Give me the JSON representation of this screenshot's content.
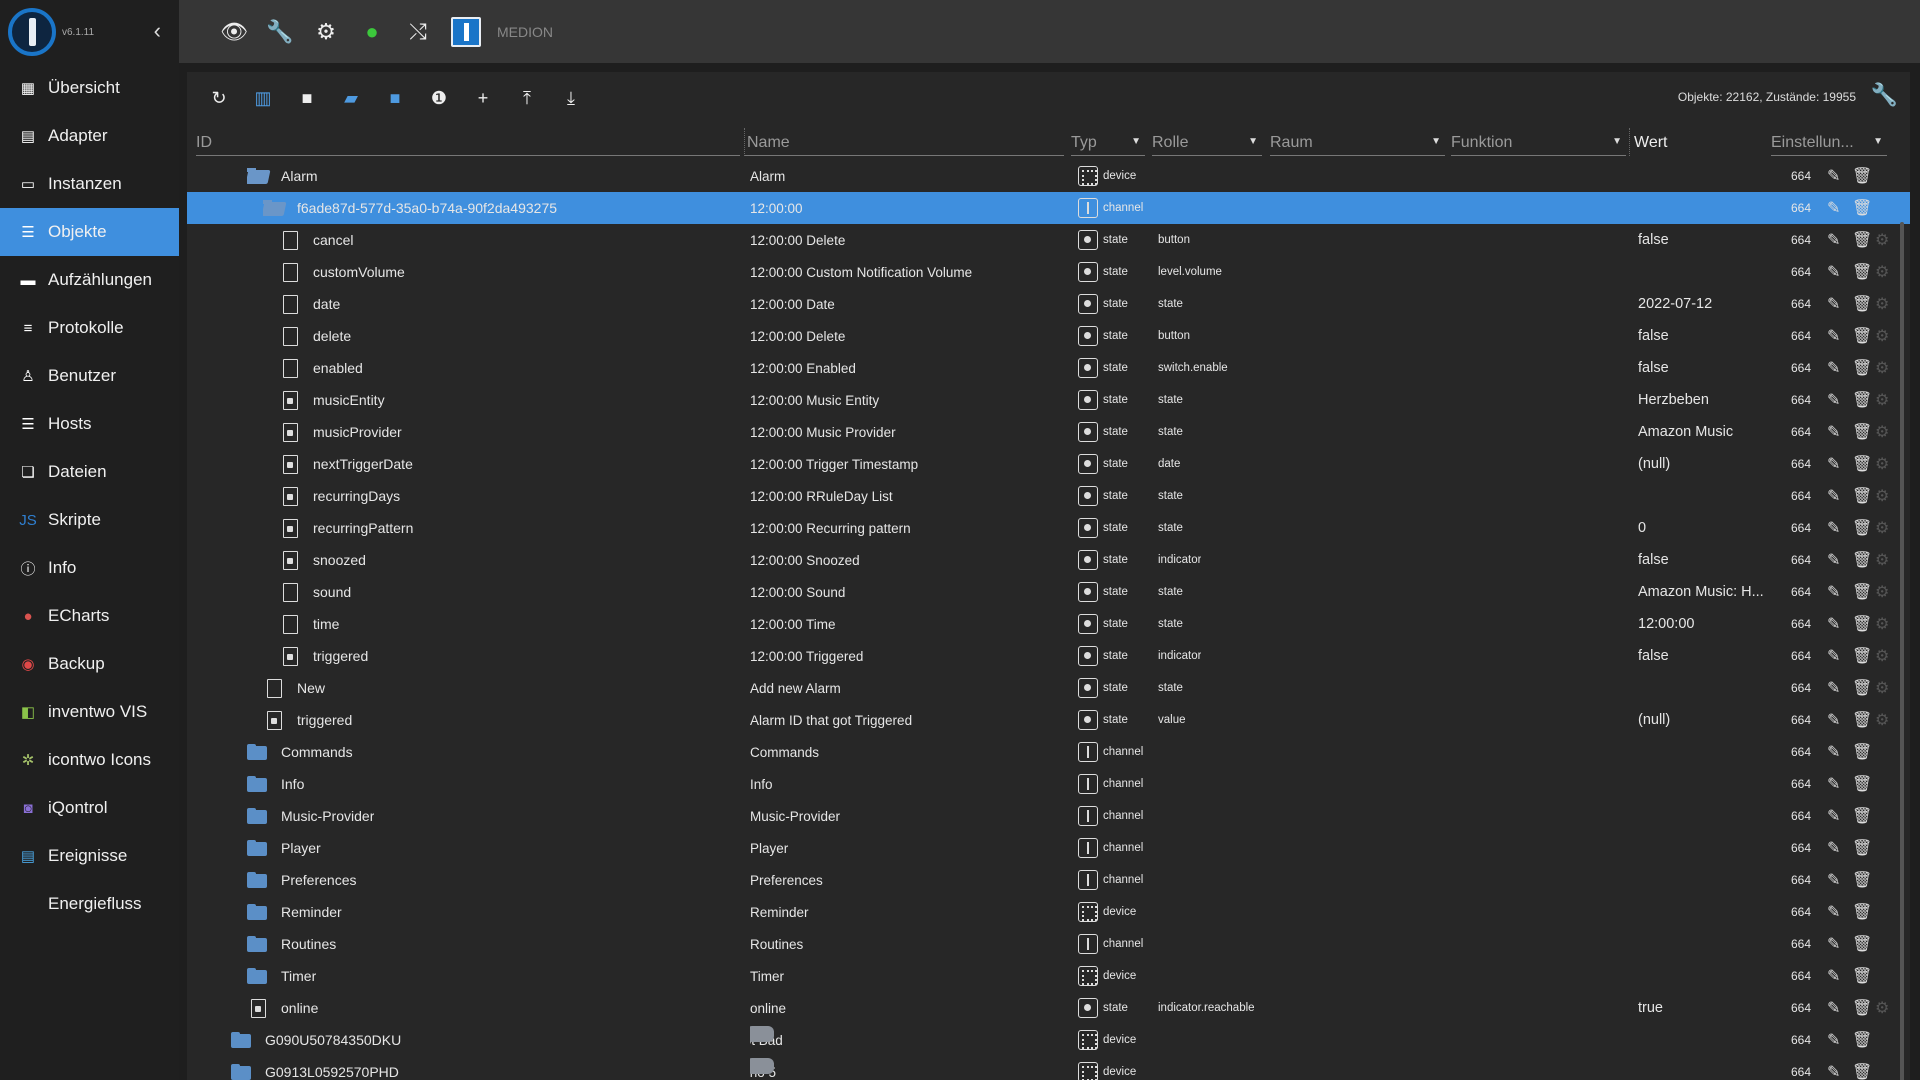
{
  "app": {
    "version": "v6.1.11",
    "hostname": "MEDION"
  },
  "sidebar": {
    "items": [
      {
        "label": "Übersicht",
        "icon": "grid-icon",
        "glyph": "▦",
        "color": "#ffffff"
      },
      {
        "label": "Adapter",
        "icon": "store-icon",
        "glyph": "▤",
        "color": "#ffffff"
      },
      {
        "label": "Instanzen",
        "icon": "instances-icon",
        "glyph": "▭",
        "color": "#ffffff"
      },
      {
        "label": "Objekte",
        "icon": "list-icon",
        "glyph": "☰",
        "color": "#ffffff",
        "active": true
      },
      {
        "label": "Aufzählungen",
        "icon": "enum-icon",
        "glyph": "▬",
        "color": "#ffffff"
      },
      {
        "label": "Protokolle",
        "icon": "log-icon",
        "glyph": "≡",
        "color": "#ffffff"
      },
      {
        "label": "Benutzer",
        "icon": "user-icon",
        "glyph": "♙",
        "color": "#ffffff"
      },
      {
        "label": "Hosts",
        "icon": "hosts-icon",
        "glyph": "☰",
        "color": "#ffffff"
      },
      {
        "label": "Dateien",
        "icon": "files-icon",
        "glyph": "❏",
        "color": "#ffffff"
      },
      {
        "label": "Skripte",
        "icon": "javascript-icon",
        "glyph": "JS",
        "color": "#2f7fd0"
      },
      {
        "label": "Info",
        "icon": "info-icon",
        "glyph": "ⓘ",
        "color": "#ffffff"
      },
      {
        "label": "ECharts",
        "icon": "echarts-icon",
        "glyph": "●",
        "color": "#d9534f"
      },
      {
        "label": "Backup",
        "icon": "backup-icon",
        "glyph": "◉",
        "color": "#e04848"
      },
      {
        "label": "inventwo VIS",
        "icon": "inventwo-icon",
        "glyph": "◧",
        "color": "#8bc34a"
      },
      {
        "label": "icontwo Icons",
        "icon": "icontwo-icon",
        "glyph": "✲",
        "color": "#a6c36a"
      },
      {
        "label": "iQontrol",
        "icon": "iqontrol-icon",
        "glyph": "◙",
        "color": "#8a6fd6"
      },
      {
        "label": "Ereignisse",
        "icon": "events-icon",
        "glyph": "▤",
        "color": "#4aa3e0"
      },
      {
        "label": "Energiefluss",
        "icon": "energy-icon",
        "glyph": "",
        "color": "#ffffff"
      }
    ]
  },
  "topbar": {
    "icons": [
      {
        "name": "eye-icon",
        "glyph": "👁",
        "color": "#eeeeee"
      },
      {
        "name": "wrench-icon",
        "glyph": "🔧",
        "color": "#eeeeee"
      },
      {
        "name": "gear-icon",
        "glyph": "⚙",
        "color": "#eeeeee"
      },
      {
        "name": "expert-head-icon",
        "glyph": "●",
        "color": "#3cc83c"
      },
      {
        "name": "sync-icon",
        "glyph": "⤭",
        "color": "#eeeeee"
      }
    ]
  },
  "toolbar": {
    "tools": [
      {
        "name": "refresh-icon",
        "glyph": "↻",
        "blue": false
      },
      {
        "name": "columns-icon",
        "glyph": "▥",
        "blue": true
      },
      {
        "name": "folder-icon",
        "glyph": "■",
        "blue": false
      },
      {
        "name": "folder-open-icon",
        "glyph": "▰",
        "blue": true
      },
      {
        "name": "folder-closed-icon",
        "glyph": "■",
        "blue": true
      },
      {
        "name": "number-one-icon",
        "glyph": "❶",
        "blue": false
      },
      {
        "name": "add-icon",
        "glyph": "+",
        "blue": false
      },
      {
        "name": "upload-icon",
        "glyph": "⤒",
        "blue": false
      },
      {
        "name": "download-icon",
        "glyph": "⤓",
        "blue": false
      }
    ],
    "counts": "Objekte: 22162, Zustände: 19955"
  },
  "columns": {
    "id": "ID",
    "name": "Name",
    "type": "Typ",
    "role": "Rolle",
    "room": "Raum",
    "function": "Funktion",
    "value": "Wert",
    "settings": "Einstellun..."
  },
  "rows": [
    {
      "indent": 1,
      "icon": "folder-open",
      "id": "Alarm",
      "name": "Alarm",
      "type": "device",
      "role": "",
      "value": "",
      "acl": "664",
      "cfg": false
    },
    {
      "indent": 2,
      "icon": "folder-open",
      "id": "f6ade87d-577d-35a0-b74a-90f2da493275",
      "name": "12:00:00",
      "type": "channel",
      "role": "",
      "value": "",
      "acl": "664",
      "cfg": false,
      "selected": true
    },
    {
      "indent": 3,
      "icon": "file",
      "id": "cancel",
      "name": "12:00:00 Delete",
      "type": "state",
      "role": "button",
      "value": "false",
      "acl": "664",
      "cfg": true
    },
    {
      "indent": 3,
      "icon": "file",
      "id": "customVolume",
      "name": "12:00:00 Custom Notification Volume",
      "type": "state",
      "role": "level.volume",
      "value": "",
      "acl": "664",
      "cfg": true
    },
    {
      "indent": 3,
      "icon": "file",
      "id": "date",
      "name": "12:00:00 Date",
      "type": "state",
      "role": "state",
      "value": "2022-07-12",
      "acl": "664",
      "cfg": true
    },
    {
      "indent": 3,
      "icon": "file",
      "id": "delete",
      "name": "12:00:00 Delete",
      "type": "state",
      "role": "button",
      "value": "false",
      "acl": "664",
      "cfg": true
    },
    {
      "indent": 3,
      "icon": "file",
      "id": "enabled",
      "name": "12:00:00 Enabled",
      "type": "state",
      "role": "switch.enable",
      "value": "false",
      "acl": "664",
      "cfg": true
    },
    {
      "indent": 3,
      "icon": "file-lock",
      "id": "musicEntity",
      "name": "12:00:00 Music Entity",
      "type": "state",
      "role": "state",
      "value": "Herzbeben",
      "acl": "664",
      "cfg": true
    },
    {
      "indent": 3,
      "icon": "file-lock",
      "id": "musicProvider",
      "name": "12:00:00 Music Provider",
      "type": "state",
      "role": "state",
      "value": "Amazon Music",
      "acl": "664",
      "cfg": true
    },
    {
      "indent": 3,
      "icon": "file-lock",
      "id": "nextTriggerDate",
      "name": "12:00:00 Trigger Timestamp",
      "type": "state",
      "role": "date",
      "value": "(null)",
      "acl": "664",
      "cfg": true
    },
    {
      "indent": 3,
      "icon": "file-lock",
      "id": "recurringDays",
      "name": "12:00:00 RRuleDay List",
      "type": "state",
      "role": "state",
      "value": "",
      "acl": "664",
      "cfg": true
    },
    {
      "indent": 3,
      "icon": "file-lock",
      "id": "recurringPattern",
      "name": "12:00:00 Recurring pattern",
      "type": "state",
      "role": "state",
      "value": "0",
      "acl": "664",
      "cfg": true
    },
    {
      "indent": 3,
      "icon": "file-lock",
      "id": "snoozed",
      "name": "12:00:00 Snoozed",
      "type": "state",
      "role": "indicator",
      "value": "false",
      "acl": "664",
      "cfg": true
    },
    {
      "indent": 3,
      "icon": "file",
      "id": "sound",
      "name": "12:00:00 Sound",
      "type": "state",
      "role": "state",
      "value": "Amazon Music: H...",
      "acl": "664",
      "cfg": true
    },
    {
      "indent": 3,
      "icon": "file",
      "id": "time",
      "name": "12:00:00 Time",
      "type": "state",
      "role": "state",
      "value": "12:00:00",
      "acl": "664",
      "cfg": true
    },
    {
      "indent": 3,
      "icon": "file-lock",
      "id": "triggered",
      "name": "12:00:00 Triggered",
      "type": "state",
      "role": "indicator",
      "value": "false",
      "acl": "664",
      "cfg": true
    },
    {
      "indent": 2,
      "icon": "file",
      "id": "New",
      "name": "Add new Alarm",
      "type": "state",
      "role": "state",
      "value": "",
      "acl": "664",
      "cfg": true
    },
    {
      "indent": 2,
      "icon": "file-lock",
      "id": "triggered",
      "name": "Alarm ID that got Triggered",
      "type": "state",
      "role": "value",
      "value": "(null)",
      "acl": "664",
      "cfg": true
    },
    {
      "indent": 1,
      "icon": "folder",
      "id": "Commands",
      "name": "Commands",
      "type": "channel",
      "role": "",
      "value": "",
      "acl": "664",
      "cfg": false
    },
    {
      "indent": 1,
      "icon": "folder",
      "id": "Info",
      "name": "Info",
      "type": "channel",
      "role": "",
      "value": "",
      "acl": "664",
      "cfg": false
    },
    {
      "indent": 1,
      "icon": "folder",
      "id": "Music-Provider",
      "name": "Music-Provider",
      "type": "channel",
      "role": "",
      "value": "",
      "acl": "664",
      "cfg": false
    },
    {
      "indent": 1,
      "icon": "folder",
      "id": "Player",
      "name": "Player",
      "type": "channel",
      "role": "",
      "value": "",
      "acl": "664",
      "cfg": false
    },
    {
      "indent": 1,
      "icon": "folder",
      "id": "Preferences",
      "name": "Preferences",
      "type": "channel",
      "role": "",
      "value": "",
      "acl": "664",
      "cfg": false
    },
    {
      "indent": 1,
      "icon": "folder",
      "id": "Reminder",
      "name": "Reminder",
      "type": "device",
      "role": "",
      "value": "",
      "acl": "664",
      "cfg": false
    },
    {
      "indent": 1,
      "icon": "folder",
      "id": "Routines",
      "name": "Routines",
      "type": "channel",
      "role": "",
      "value": "",
      "acl": "664",
      "cfg": false
    },
    {
      "indent": 1,
      "icon": "folder",
      "id": "Timer",
      "name": "Timer",
      "type": "device",
      "role": "",
      "value": "",
      "acl": "664",
      "cfg": false
    },
    {
      "indent": 1,
      "icon": "file-lock",
      "id": "online",
      "name": "online",
      "type": "state",
      "role": "indicator.reachable",
      "value": "true",
      "acl": "664",
      "cfg": true
    },
    {
      "indent": 0,
      "icon": "folder",
      "id": "G090U50784350DKU",
      "name": "Dot Bad",
      "name_icon": true,
      "type": "device",
      "role": "",
      "value": "",
      "acl": "664",
      "cfg": false
    },
    {
      "indent": 0,
      "icon": "folder",
      "id": "G0913L0592570PHD",
      "name": "Echo 5",
      "name_icon": true,
      "type": "device",
      "role": "",
      "value": "",
      "acl": "664",
      "cfg": false
    }
  ]
}
